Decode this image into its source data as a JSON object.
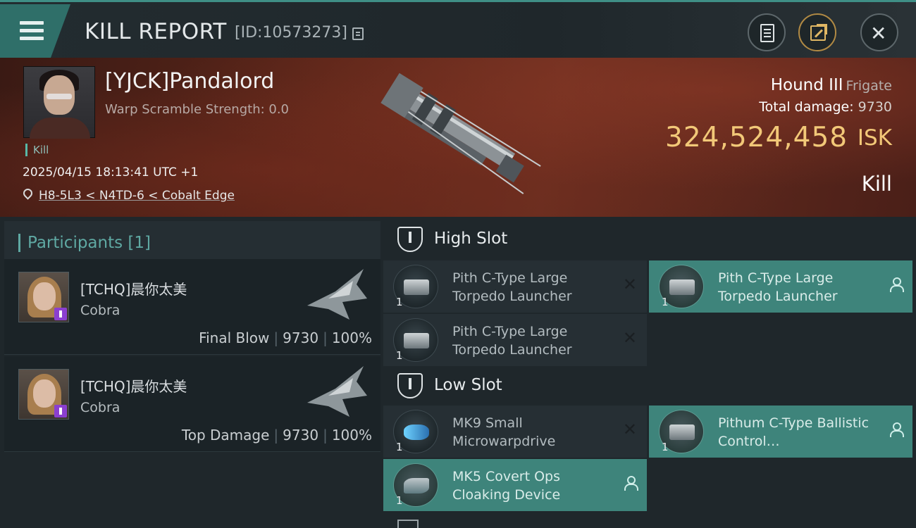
{
  "header": {
    "title": "KILL REPORT",
    "report_id": "[ID:10573273]"
  },
  "victim": {
    "pilot": "[YJCK]Pandalord",
    "warp_scramble": "Warp Scramble Strength: 0.0",
    "tag": "Kill",
    "datetime": "2025/04/15 18:13:41 UTC +1",
    "location": "H8-5L3 < N4TD-6 < Cobalt Edge",
    "ship_name": "Hound III",
    "ship_class": "Frigate",
    "total_damage_label": "Total damage:",
    "total_damage": "9730",
    "isk_value": "324,524,458",
    "isk_unit": "ISK",
    "result": "Kill"
  },
  "participants": {
    "label": "Participants [1]",
    "rows": [
      {
        "name": "[TCHQ]晨你太美",
        "ship": "Cobra",
        "role": "Final Blow",
        "damage": "9730",
        "percent": "100%"
      },
      {
        "name": "[TCHQ]晨你太美",
        "ship": "Cobra",
        "role": "Top Damage",
        "damage": "9730",
        "percent": "100%"
      }
    ]
  },
  "slots": {
    "high": {
      "label": "High Slot",
      "modules": [
        {
          "qty": "1",
          "name": "Pith C-Type Large Torpedo Launcher",
          "state": "destroyed"
        },
        {
          "qty": "1",
          "name": "Pith C-Type Large Torpedo Launcher",
          "state": "dropped"
        },
        {
          "qty": "1",
          "name": "Pith C-Type Large Torpedo Launcher",
          "state": "destroyed"
        }
      ]
    },
    "low": {
      "label": "Low Slot",
      "modules": [
        {
          "qty": "1",
          "name": "MK9 Small Microwarpdrive",
          "state": "destroyed"
        },
        {
          "qty": "1",
          "name": "Pithum C-Type Ballistic Control…",
          "state": "dropped"
        },
        {
          "qty": "1",
          "name": "MK5 Covert Ops Cloaking Device",
          "state": "dropped"
        }
      ]
    }
  },
  "colors": {
    "accent_teal": "#3e847b",
    "isk_gold": "#f2c878",
    "hero_red": "#5a2519"
  },
  "icons": [
    "menu-icon",
    "copy-icon",
    "notes-icon",
    "share-icon",
    "close-icon",
    "location-pin-icon",
    "slot-icon",
    "destroyed-x-icon",
    "person-icon"
  ]
}
